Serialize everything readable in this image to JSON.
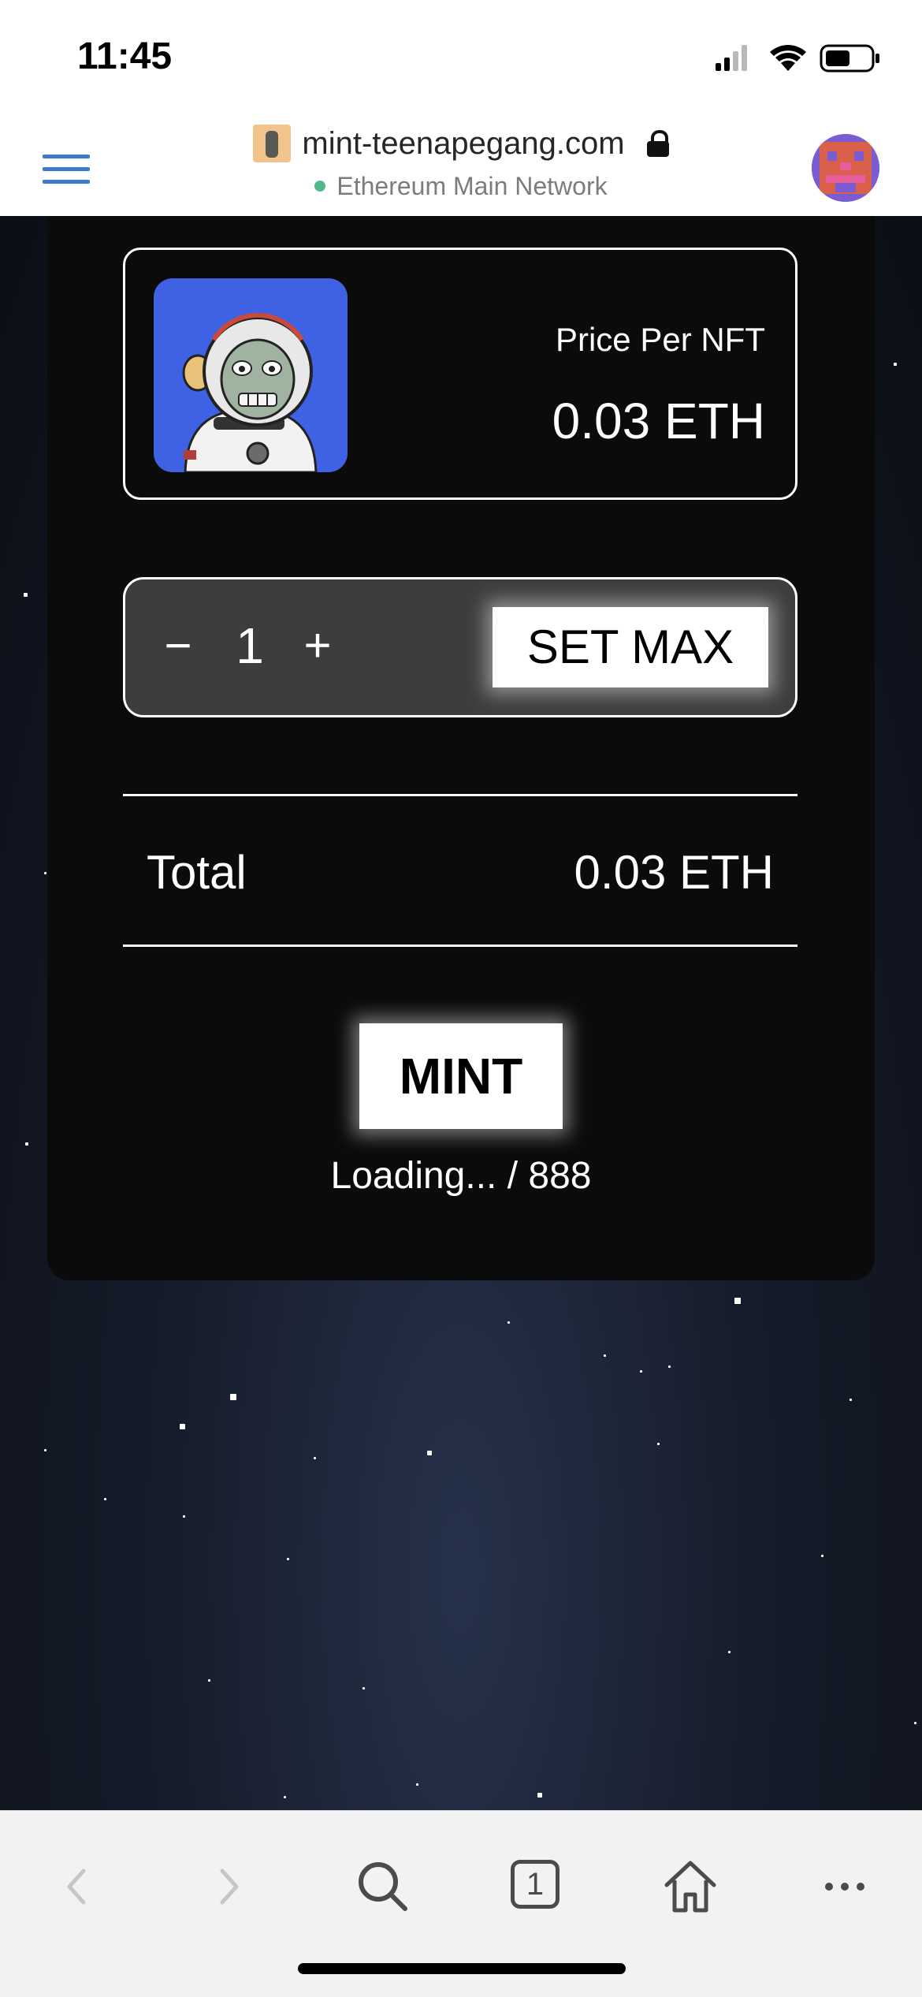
{
  "status_bar": {
    "time": "11:45"
  },
  "browser": {
    "url": "mint-teenapegang.com",
    "network": "Ethereum Main Network",
    "accent_color": "#3a79c9",
    "network_status_color": "#51b88e"
  },
  "nft": {
    "price_label": "Price Per NFT",
    "price_value": "0.03 ETH",
    "image_background": "#3e62e3"
  },
  "quantity": {
    "minus_label": "−",
    "value": "1",
    "plus_label": "+",
    "set_max_label": "SET MAX"
  },
  "total": {
    "label": "Total",
    "value": "0.03 ETH"
  },
  "mint": {
    "button_label": "MINT",
    "supply_text": "Loading... / 888"
  },
  "toolbar": {
    "tab_count": "1",
    "icons": [
      "back-arrow-icon",
      "forward-arrow-icon",
      "search-icon",
      "tabs-icon",
      "home-icon",
      "more-icon"
    ]
  }
}
